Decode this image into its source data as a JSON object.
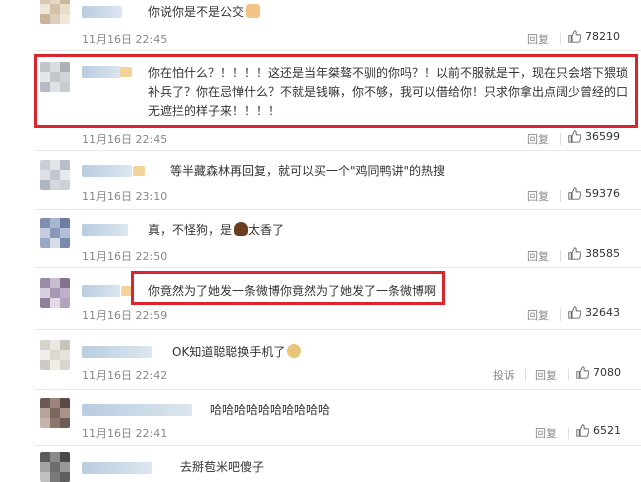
{
  "comments": [
    {
      "text": "你说你是不是公交",
      "emoji": "person-emoji",
      "time": "11月16日 22:45",
      "reply": "回复",
      "likes": "78210"
    },
    {
      "text": "你在怕什么？！！！！这还是当年桀骜不驯的你吗？！以前不服就是干，现在只会塔下猥琐补兵了？你在忌惮什么？不就是钱嘛，你不够，我可以借给你！只求你拿出点阔少曾经的口无遮拦的样子来！！！！",
      "time": "11月16日 22:45",
      "reply": "回复",
      "likes": "36599"
    },
    {
      "text": "等半藏森林再回复，就可以买一个\"鸡同鸭讲\"的热搜",
      "time": "11月16日 23:10",
      "reply": "回复",
      "likes": "59376"
    },
    {
      "text_before": "真，不怪狗，是",
      "emoji": "poop-emoji",
      "text_after": "太香了",
      "time": "11月16日 22:50",
      "reply": "回复",
      "likes": "38585"
    },
    {
      "text": "你竟然为了她发一条微博你竟然为了她发了一条微博啊",
      "time": "11月16日 22:59",
      "reply": "回复",
      "likes": "32643"
    },
    {
      "text": "OK知道聪聪换手机了",
      "emoji": "dog-emoji",
      "time": "11月16日 22:42",
      "report": "投诉",
      "reply": "回复",
      "likes": "7080"
    },
    {
      "text": "哈哈哈哈哈哈哈哈哈哈",
      "time": "11月16日 22:41",
      "reply": "回复",
      "likes": "6521"
    },
    {
      "text": "去掰苞米吧傻子"
    }
  ],
  "icons": {
    "like": "thumbs-up-icon"
  },
  "colors": {
    "highlight": "#d9262c",
    "meta": "#888888"
  }
}
